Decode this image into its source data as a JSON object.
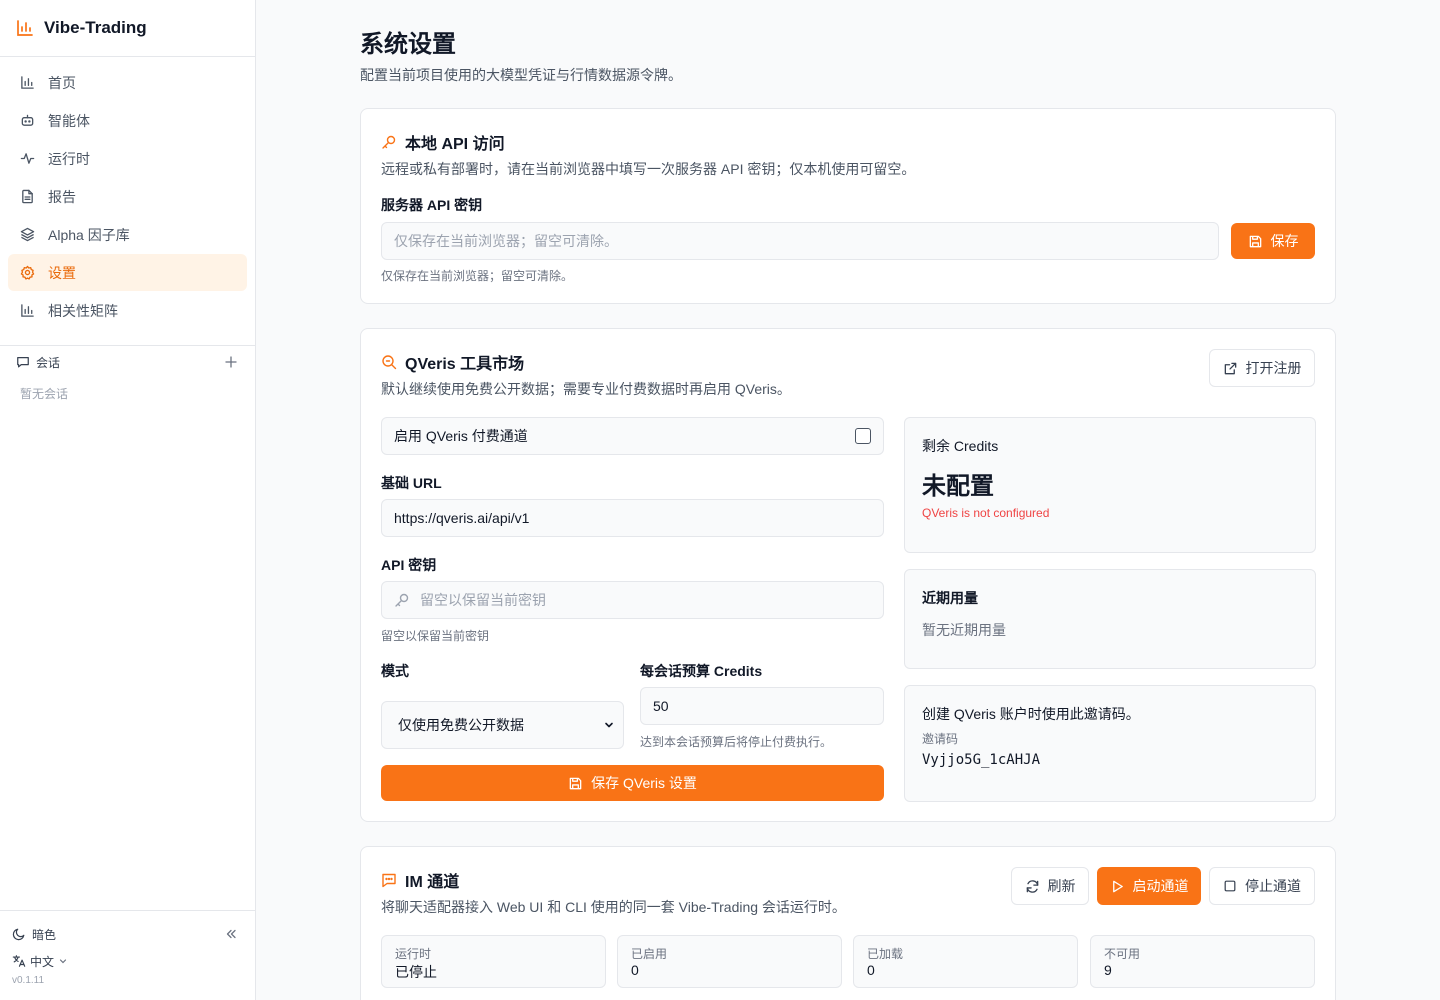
{
  "app": {
    "name": "Vibe-Trading",
    "version": "v0.1.11",
    "accent": "#f97316"
  },
  "sidebar": {
    "items": [
      {
        "label": "首页",
        "icon": "bar-chart-icon"
      },
      {
        "label": "智能体",
        "icon": "bot-icon"
      },
      {
        "label": "运行时",
        "icon": "activity-icon"
      },
      {
        "label": "报告",
        "icon": "file-text-icon"
      },
      {
        "label": "Alpha 因子库",
        "icon": "layers-icon"
      },
      {
        "label": "设置",
        "icon": "gear-icon",
        "active": true
      },
      {
        "label": "相关性矩阵",
        "icon": "bar-chart-icon"
      }
    ],
    "conversations_label": "会话",
    "conversations_empty": "暂无会话",
    "theme_label": "暗色",
    "language_label": "中文"
  },
  "page": {
    "title": "系统设置",
    "subtitle": "配置当前项目使用的大模型凭证与行情数据源令牌。"
  },
  "local_api": {
    "title": "本地 API 访问",
    "description": "远程或私有部署时，请在当前浏览器中填写一次服务器 API 密钥；仅本机使用可留空。",
    "field_label": "服务器 API 密钥",
    "placeholder": "仅保存在当前浏览器；留空可清除。",
    "hint": "仅保存在当前浏览器；留空可清除。",
    "save_label": "保存"
  },
  "qveris": {
    "title": "QVeris 工具市场",
    "description": "默认继续使用免费公开数据；需要专业付费数据时再启用 QVeris。",
    "open_register_label": "打开注册",
    "enable_label": "启用 QVeris 付费通道",
    "enabled": false,
    "base_url_label": "基础 URL",
    "base_url_value": "https://qveris.ai/api/v1",
    "api_key_label": "API 密钥",
    "api_key_placeholder": "留空以保留当前密钥",
    "api_key_hint": "留空以保留当前密钥",
    "mode_label": "模式",
    "mode_value": "仅使用免费公开数据",
    "budget_label": "每会话预算 Credits",
    "budget_value": "50",
    "budget_hint": "达到本会话预算后将停止付费执行。",
    "save_label": "保存 QVeris 设置",
    "credits_label": "剩余 Credits",
    "credits_value": "未配置",
    "credits_error": "QVeris is not configured",
    "usage_label": "近期用量",
    "usage_empty": "暂无近期用量",
    "invite_title": "创建 QVeris 账户时使用此邀请码。",
    "invite_label": "邀请码",
    "invite_code": "Vyjjo5G_1cAHJA"
  },
  "im": {
    "title": "IM 通道",
    "description": "将聊天适配器接入 Web UI 和 CLI 使用的同一套 Vibe-Trading 会话运行时。",
    "refresh_label": "刷新",
    "start_label": "启动通道",
    "stop_label": "停止通道",
    "stats": [
      {
        "label": "运行时",
        "value": "已停止"
      },
      {
        "label": "已启用",
        "value": "0"
      },
      {
        "label": "已加载",
        "value": "0"
      },
      {
        "label": "不可用",
        "value": "9"
      }
    ]
  }
}
